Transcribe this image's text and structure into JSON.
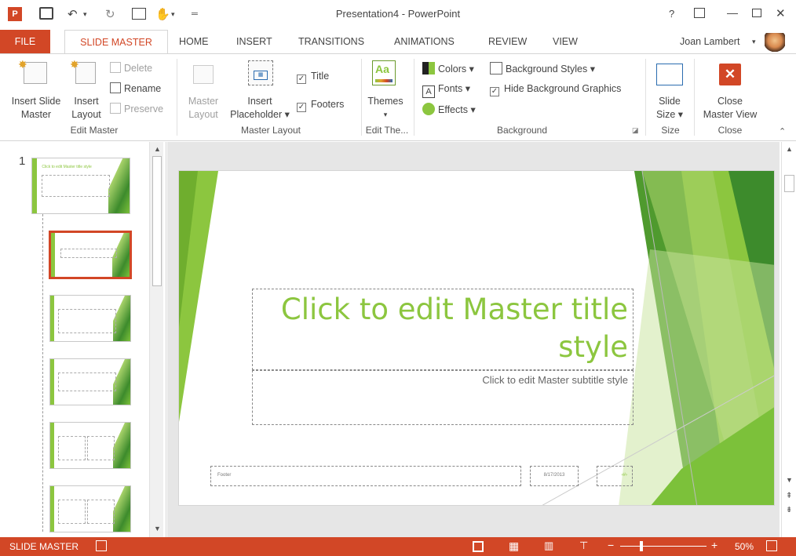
{
  "window": {
    "title": "Presentation4 - PowerPoint",
    "help": "?",
    "controls": [
      "⊟",
      "—",
      "☐",
      "✕"
    ]
  },
  "qat": {
    "app_icon": "P",
    "save": "🖫",
    "undo": "↶",
    "redo": "↻"
  },
  "tabs": [
    "FILE",
    "SLIDE MASTER",
    "HOME",
    "INSERT",
    "TRANSITIONS",
    "ANIMATIONS",
    "REVIEW",
    "VIEW"
  ],
  "user": {
    "name": "Joan Lambert"
  },
  "ribbon": {
    "edit_master": {
      "group": "Edit Master",
      "insert_slide_master": [
        "Insert Slide",
        "Master"
      ],
      "insert_layout": [
        "Insert",
        "Layout"
      ],
      "delete": "Delete",
      "rename": "Rename",
      "preserve": "Preserve"
    },
    "master_layout": {
      "group": "Master Layout",
      "master_layout": [
        "Master",
        "Layout"
      ],
      "insert_placeholder": [
        "Insert",
        "Placeholder ▾"
      ],
      "title": "Title",
      "footers": "Footers"
    },
    "edit_theme": {
      "group": "Edit The...",
      "themes": "Themes"
    },
    "background": {
      "group": "Background",
      "colors": "Colors ▾",
      "fonts": "Fonts ▾",
      "effects": "Effects ▾",
      "background_styles": "Background Styles ▾",
      "hide_bg": "Hide Background Graphics"
    },
    "size": {
      "group": "Size",
      "slide_size": [
        "Slide",
        "Size ▾"
      ]
    },
    "close": {
      "group": "Close",
      "close_master": [
        "Close",
        "Master View"
      ]
    }
  },
  "thumbnails": {
    "number": "1",
    "master_title": "Click to edit Master title style"
  },
  "slide": {
    "title_line1": "Click to edit Master title",
    "title_line2": "style",
    "subtitle": "Click to edit Master subtitle style",
    "footer": "Footer",
    "date": "8/17/2013",
    "number": "‹#›"
  },
  "status": {
    "mode": "SLIDE MASTER",
    "zoom": "50%"
  },
  "colors": {
    "accent": "#d24726",
    "theme_green": "#8cc63f"
  }
}
